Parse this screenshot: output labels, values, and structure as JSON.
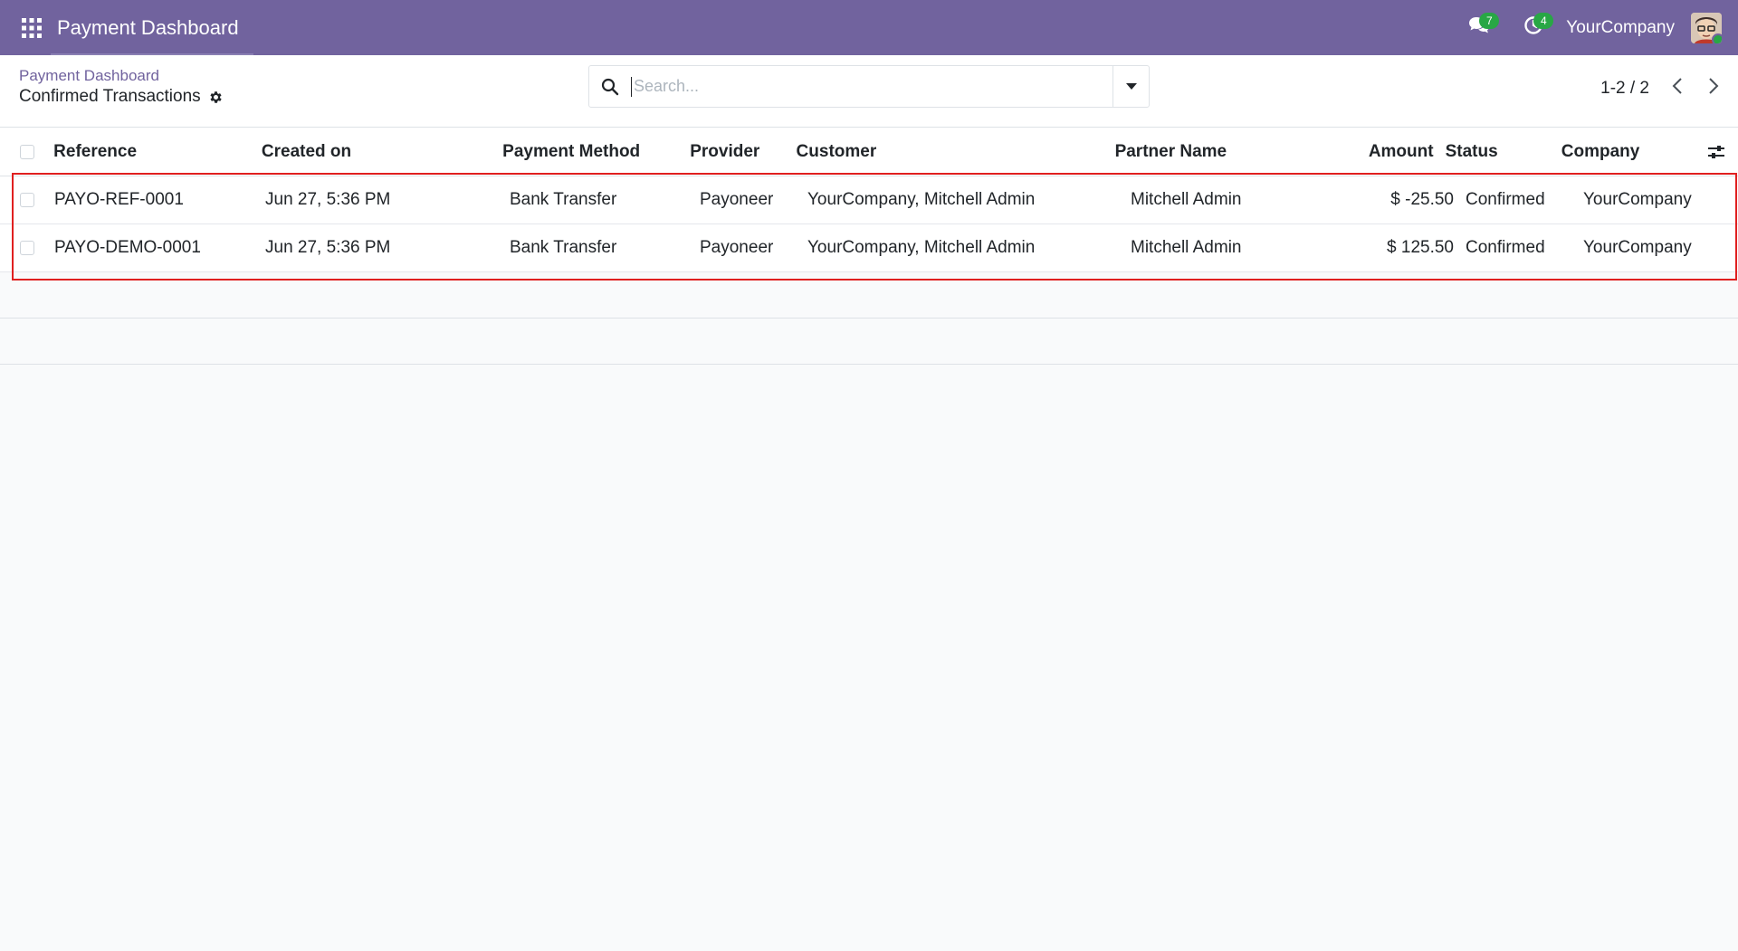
{
  "navbar": {
    "app_title": "Payment Dashboard",
    "messages_count": "7",
    "activities_count": "4",
    "company": "YourCompany"
  },
  "breadcrumb": {
    "parent": "Payment Dashboard",
    "current": "Confirmed Transactions"
  },
  "search": {
    "placeholder": "Search...",
    "value": ""
  },
  "pager": {
    "value": "1-2 / 2"
  },
  "table": {
    "columns": [
      "Reference",
      "Created on",
      "Payment Method",
      "Provider",
      "Customer",
      "Partner Name",
      "Amount",
      "Status",
      "Company"
    ],
    "rows": [
      [
        "PAYO-REF-0001",
        "Jun 27, 5:36 PM",
        "Bank Transfer",
        "Payoneer",
        "YourCompany, Mitchell Admin",
        "Mitchell Admin",
        "$ -25.50",
        "Confirmed",
        "YourCompany"
      ],
      [
        "PAYO-DEMO-0001",
        "Jun 27, 5:36 PM",
        "Bank Transfer",
        "Payoneer",
        "YourCompany, Mitchell Admin",
        "Mitchell Admin",
        "$ 125.50",
        "Confirmed",
        "YourCompany"
      ]
    ]
  },
  "colors": {
    "navbar": "#71639e",
    "accent": "#71639e",
    "badge": "#28a745",
    "highlight": "#e02020"
  },
  "icons": [
    "apps-grid-icon",
    "chat-icon",
    "clock-icon",
    "gear-icon",
    "search-icon",
    "caret-down-icon",
    "chevron-left-icon",
    "chevron-right-icon",
    "column-options-icon"
  ]
}
